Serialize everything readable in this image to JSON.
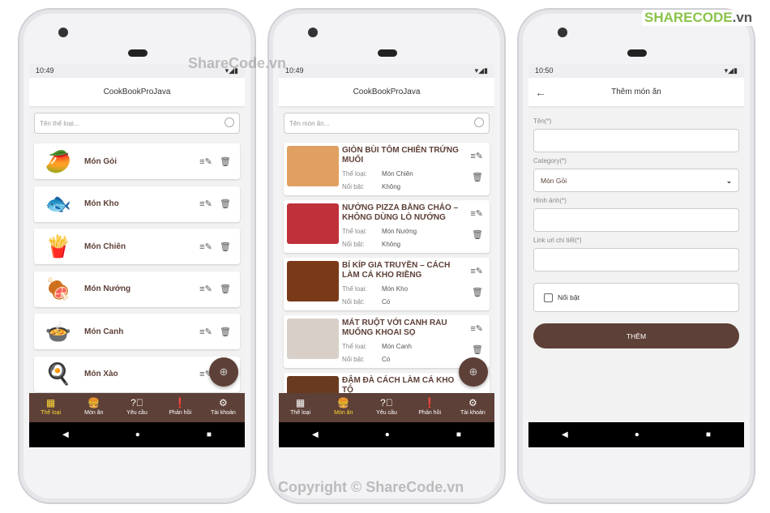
{
  "watermark": {
    "top": "ShareCode.vn",
    "bottom": "Copyright © ShareCode.vn",
    "logo": "SHARECODE",
    "logo_suffix": ".vn"
  },
  "colors": {
    "primary": "#5d4037",
    "active": "#fdd835"
  },
  "screen1": {
    "time": "10:49",
    "title": "CookBookProJava",
    "search_placeholder": "Tên thể loại...",
    "categories": [
      {
        "name": "Món Gỏi",
        "icon": "🥭"
      },
      {
        "name": "Món Kho",
        "icon": "🐟"
      },
      {
        "name": "Món Chiên",
        "icon": "🍟"
      },
      {
        "name": "Món Nướng",
        "icon": "🍖"
      },
      {
        "name": "Món Canh",
        "icon": "🍲"
      },
      {
        "name": "Món  Xào",
        "icon": "🍳"
      }
    ]
  },
  "screen2": {
    "time": "10:49",
    "title": "CookBookProJava",
    "search_placeholder": "Tên món ăn...",
    "type_label": "Thể loại:",
    "featured_label": "Nổi bật:",
    "foods": [
      {
        "title": "GIÒN BÙI TÔM CHIÊN TRỨNG MUỐI",
        "category": "Món Chiên",
        "featured": "Không",
        "color": "#e0a060"
      },
      {
        "title": "NƯỚNG PIZZA BẰNG CHẢO – KHÔNG DÙNG LÒ NƯỚNG",
        "category": "Món Nướng",
        "featured": "Không",
        "color": "#c0303a"
      },
      {
        "title": "BÍ KÍP GIA TRUYỀN – CÁCH LÀM CÁ KHO RIỀNG",
        "category": "Món Kho",
        "featured": "Có",
        "color": "#7a3a18"
      },
      {
        "title": "MÁT RUỘT VỚI CANH RAU MUỐNG KHOAI SỌ",
        "category": "Món Canh",
        "featured": "Có",
        "color": "#d8d0c8"
      },
      {
        "title": "ĐẬM ĐÀ CÁCH LÀM CÁ KHO TỘ",
        "color": "#6a3a20"
      }
    ]
  },
  "screen3": {
    "time": "10:50",
    "title": "Thêm món ăn",
    "name_label": "Tên(*)",
    "name_value": "",
    "category_label": "Category(*)",
    "category_value": "Món Gỏi",
    "image_label": "Hình ảnh(*)",
    "image_value": "",
    "link_label": "Link url chi tiết(*)",
    "link_value": "",
    "featured_label": "Nổi bật",
    "featured_checked": false,
    "submit": "THÊM"
  },
  "nav": [
    {
      "label": "Thể loại",
      "icon": "grid-icon"
    },
    {
      "label": "Món ăn",
      "icon": "food-icon"
    },
    {
      "label": "Yêu cầu",
      "icon": "help-icon"
    },
    {
      "label": "Phản hồi",
      "icon": "feedback-icon"
    },
    {
      "label": "Tài khoản",
      "icon": "gear-icon"
    }
  ]
}
